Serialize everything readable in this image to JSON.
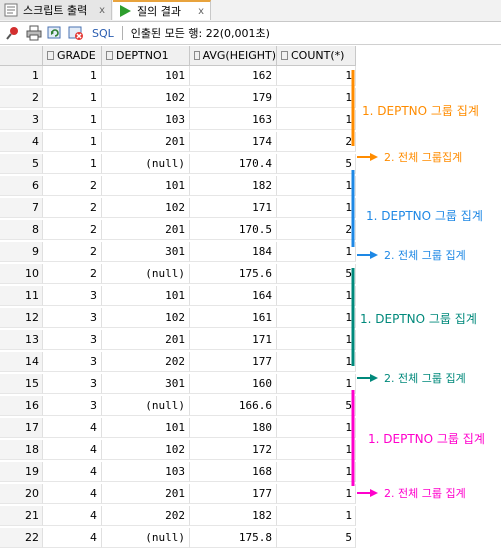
{
  "tabs": [
    {
      "label": "스크립트 출력",
      "close": "x"
    },
    {
      "label": "질의 결과",
      "close": "x"
    }
  ],
  "toolbar": {
    "sql_label": "SQL",
    "status": "인출된 모든 행: 22(0,001초)"
  },
  "columns": [
    "",
    "GRADE",
    "DEPTNO1",
    "AVG(HEIGHT)",
    "COUNT(*)"
  ],
  "rows": [
    [
      "1",
      "1",
      "101",
      "162",
      "1"
    ],
    [
      "2",
      "1",
      "102",
      "179",
      "1"
    ],
    [
      "3",
      "1",
      "103",
      "163",
      "1"
    ],
    [
      "4",
      "1",
      "201",
      "174",
      "2"
    ],
    [
      "5",
      "1",
      "(null)",
      "170.4",
      "5"
    ],
    [
      "6",
      "2",
      "101",
      "182",
      "1"
    ],
    [
      "7",
      "2",
      "102",
      "171",
      "1"
    ],
    [
      "8",
      "2",
      "201",
      "170.5",
      "2"
    ],
    [
      "9",
      "2",
      "301",
      "184",
      "1"
    ],
    [
      "10",
      "2",
      "(null)",
      "175.6",
      "5"
    ],
    [
      "11",
      "3",
      "101",
      "164",
      "1"
    ],
    [
      "12",
      "3",
      "102",
      "161",
      "1"
    ],
    [
      "13",
      "3",
      "201",
      "171",
      "1"
    ],
    [
      "14",
      "3",
      "202",
      "177",
      "1"
    ],
    [
      "15",
      "3",
      "301",
      "160",
      "1"
    ],
    [
      "16",
      "3",
      "(null)",
      "166.6",
      "5"
    ],
    [
      "17",
      "4",
      "101",
      "180",
      "1"
    ],
    [
      "18",
      "4",
      "102",
      "172",
      "1"
    ],
    [
      "19",
      "4",
      "103",
      "168",
      "1"
    ],
    [
      "20",
      "4",
      "201",
      "177",
      "1"
    ],
    [
      "21",
      "4",
      "202",
      "182",
      "1"
    ],
    [
      "22",
      "4",
      "(null)",
      "175.8",
      "5"
    ]
  ],
  "annotations": [
    {
      "group_label": "1. DEPTNO 그룹 집계",
      "total_label": "2. 전체 그룹집계",
      "color": "#ff8c00"
    },
    {
      "group_label": "1. DEPTNO 그룹 집계",
      "total_label": "2. 전체 그룹 집계",
      "color": "#1e88e5"
    },
    {
      "group_label": "1. DEPTNO 그룹 집계",
      "total_label": "2. 전체 그룹 집계",
      "color": "#00897b"
    },
    {
      "group_label": "1. DEPTNO 그룹 집계",
      "total_label": "2. 전체 그룹 집계",
      "color": "#ff00cc"
    }
  ]
}
